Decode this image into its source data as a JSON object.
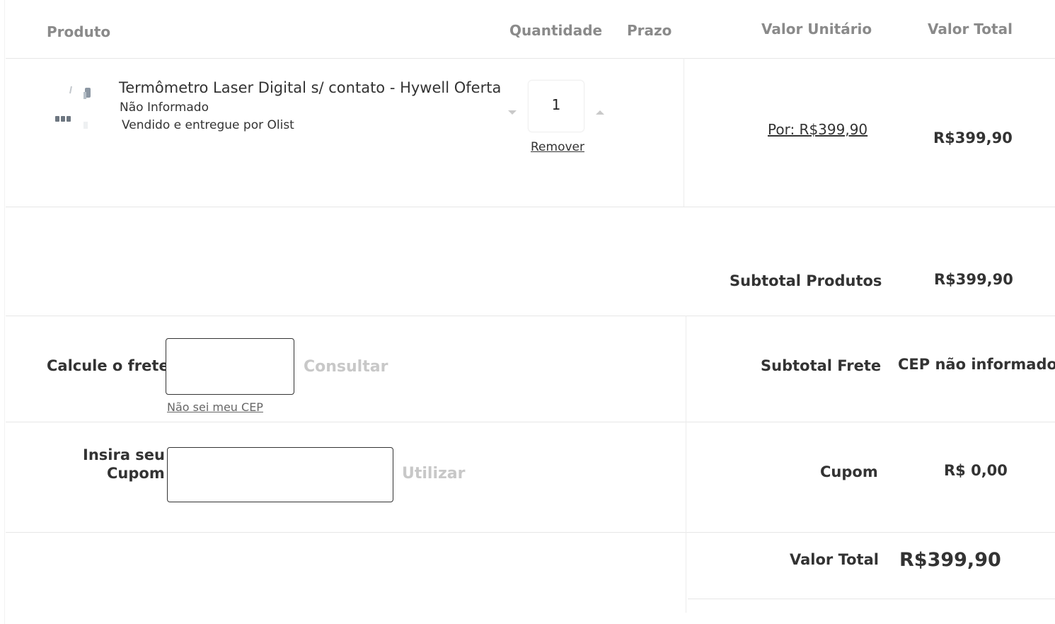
{
  "table_header": {
    "product": "Produto",
    "quantity": "Quantidade",
    "deadline": "Prazo",
    "unit_value": "Valor Unitário",
    "total_value": "Valor Total"
  },
  "item": {
    "name": "Termômetro Laser Digital s/ contato - Hywell Oferta",
    "variant": "Não Informado",
    "seller": "Vendido e entregue por Olist",
    "quantity": "1",
    "remove_label": "Remover",
    "unit_price": "Por: R$399,90",
    "total_price": "R$399,90"
  },
  "summary": {
    "subtotal_products_label": "Subtotal Produtos",
    "subtotal_products_value": "R$399,90",
    "subtotal_shipping_label": "Subtotal Frete",
    "subtotal_shipping_value": "CEP não informado",
    "coupon_label": "Cupom",
    "coupon_value": "R$ 0,00",
    "total_label": "Valor Total",
    "total_value": "R$399,90"
  },
  "shipping": {
    "label": "Calcule o frete",
    "input_value": "",
    "button_label": "Consultar",
    "help_link": "Não sei meu CEP"
  },
  "coupon": {
    "label_line1": "Insira seu",
    "label_line2": "Cupom",
    "input_value": "",
    "button_label": "Utilizar"
  },
  "icons": {
    "product_image": "thermometer-product-icon",
    "decrease": "chevron-down-icon",
    "increase": "chevron-up-icon"
  }
}
